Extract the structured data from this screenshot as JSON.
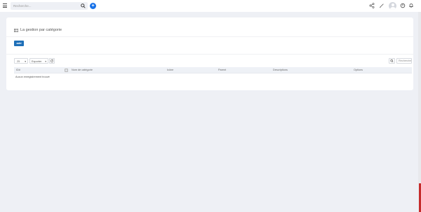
{
  "topbar": {
    "search_placeholder": "Recherche...",
    "icons": [
      "menu-icon",
      "search-icon",
      "add-icon",
      "share-icon",
      "edit-icon",
      "user-avatar",
      "power-icon",
      "bell-icon"
    ],
    "accent_color": "#1a73e8"
  },
  "page": {
    "title": "La gestion par catégorie",
    "add_label": "add"
  },
  "table": {
    "length_value": "25",
    "export_label": "Exporter",
    "search_placeholder": "Recherche",
    "columns": [
      "ID#",
      "Nom de catégorie",
      "Icône",
      "Parent",
      "Descriptions",
      "Options"
    ],
    "empty_message": "Aucun enregistrement trouvé"
  }
}
